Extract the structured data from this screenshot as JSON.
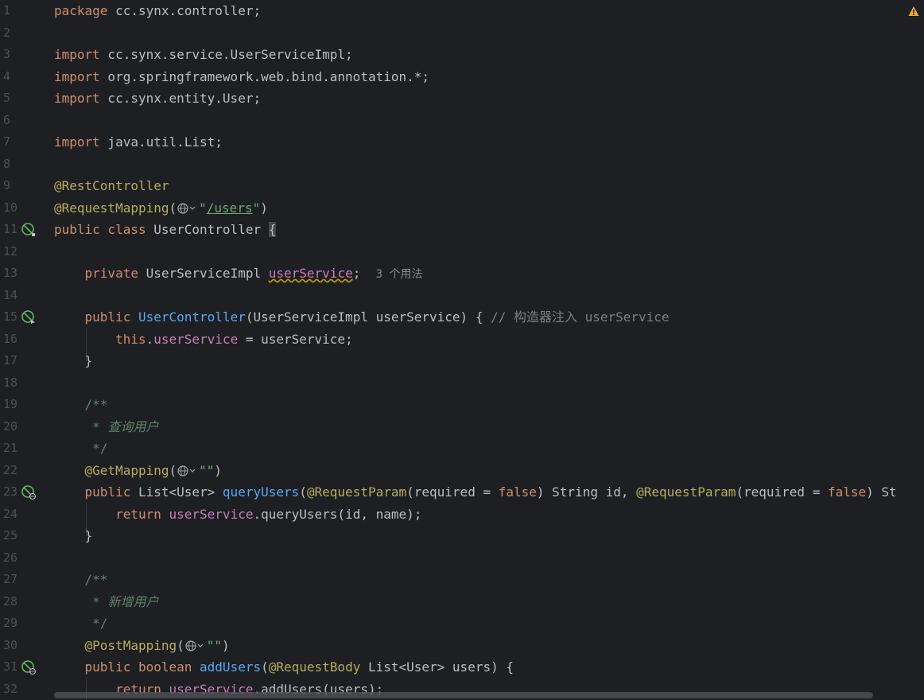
{
  "editor": {
    "warning_icon": "warning-triangle-icon",
    "line_numbers": [
      "1",
      "2",
      "3",
      "4",
      "5",
      "6",
      "7",
      "8",
      "9",
      "10",
      "11",
      "12",
      "13",
      "14",
      "15",
      "16",
      "17",
      "18",
      "19",
      "20",
      "21",
      "22",
      "23",
      "24",
      "25",
      "26",
      "27",
      "28",
      "29",
      "30",
      "31",
      "32"
    ],
    "code": {
      "l1_kw": "package",
      "l1_rest": " cc.synx.controller;",
      "l3_kw": "import",
      "l3_rest": " cc.synx.service.UserServiceImpl;",
      "l4_kw": "import",
      "l4_rest": " org.springframework.web.bind.annotation.*;",
      "l5_kw": "import",
      "l5_rest": " cc.synx.entity.User;",
      "l7_kw": "import",
      "l7_rest": " java.util.List;",
      "l9_ann": "@RestController",
      "l10_ann": "@RequestMapping",
      "l10_open": "(",
      "l10_q1": "\"",
      "l10_url": "/users",
      "l10_q2": "\"",
      "l10_close": ")",
      "l11_kw": "public class",
      "l11_name": " UserController ",
      "l11_brace": "{",
      "l13_kw": "private",
      "l13_type": " UserServiceImpl ",
      "l13_field": "userService",
      "l13_semi": ";",
      "l13_hint": "3 个用法",
      "l15_kw": "public",
      "l15_fn": "UserController",
      "l15_params": "(UserServiceImpl userService) { ",
      "l15_cmt": "// 构造器注入 userService",
      "l16_kw": "this",
      "l16_dot": ".",
      "l16_field": "userService",
      "l16_rest": " = userService;",
      "l17": "}",
      "l19": "/**",
      "l20_star": " * ",
      "l20_text": "查询用户",
      "l21": " */",
      "l22_ann": "@GetMapping",
      "l22_open": "(",
      "l22_str": "\"\"",
      "l22_close": ")",
      "l23_kw": "public",
      "l23_type": " List<User> ",
      "l23_fn": "queryUsers",
      "l23_a": "(",
      "l23_ann1": "@RequestParam",
      "l23_b": "(required = ",
      "l23_false1": "false",
      "l23_c": ") String id, ",
      "l23_ann2": "@RequestParam",
      "l23_d": "(required = ",
      "l23_false2": "false",
      "l23_e": ") St",
      "l24_kw": "return",
      "l24_sp": " ",
      "l24_field": "userService",
      "l24_rest": ".queryUsers(id, name);",
      "l25": "}",
      "l27": "/**",
      "l28_star": " * ",
      "l28_text": "新增用户",
      "l29": " */",
      "l30_ann": "@PostMapping",
      "l30_open": "(",
      "l30_str": "\"\"",
      "l30_close": ")",
      "l31_kw": "public boolean",
      "l31_sp": " ",
      "l31_fn": "addUsers",
      "l31_a": "(",
      "l31_ann": "@RequestBody",
      "l31_rest": " List<User> users) {",
      "l32_kw": "return",
      "l32_sp": " ",
      "l32_field": "userService",
      "l32_rest": ".addUsers(users);"
    }
  },
  "gutter_icons": {
    "line11": "spring-bean-icon",
    "line15": "spring-inject-icon",
    "line23": "web-endpoint-icon",
    "line31": "web-endpoint-icon"
  }
}
